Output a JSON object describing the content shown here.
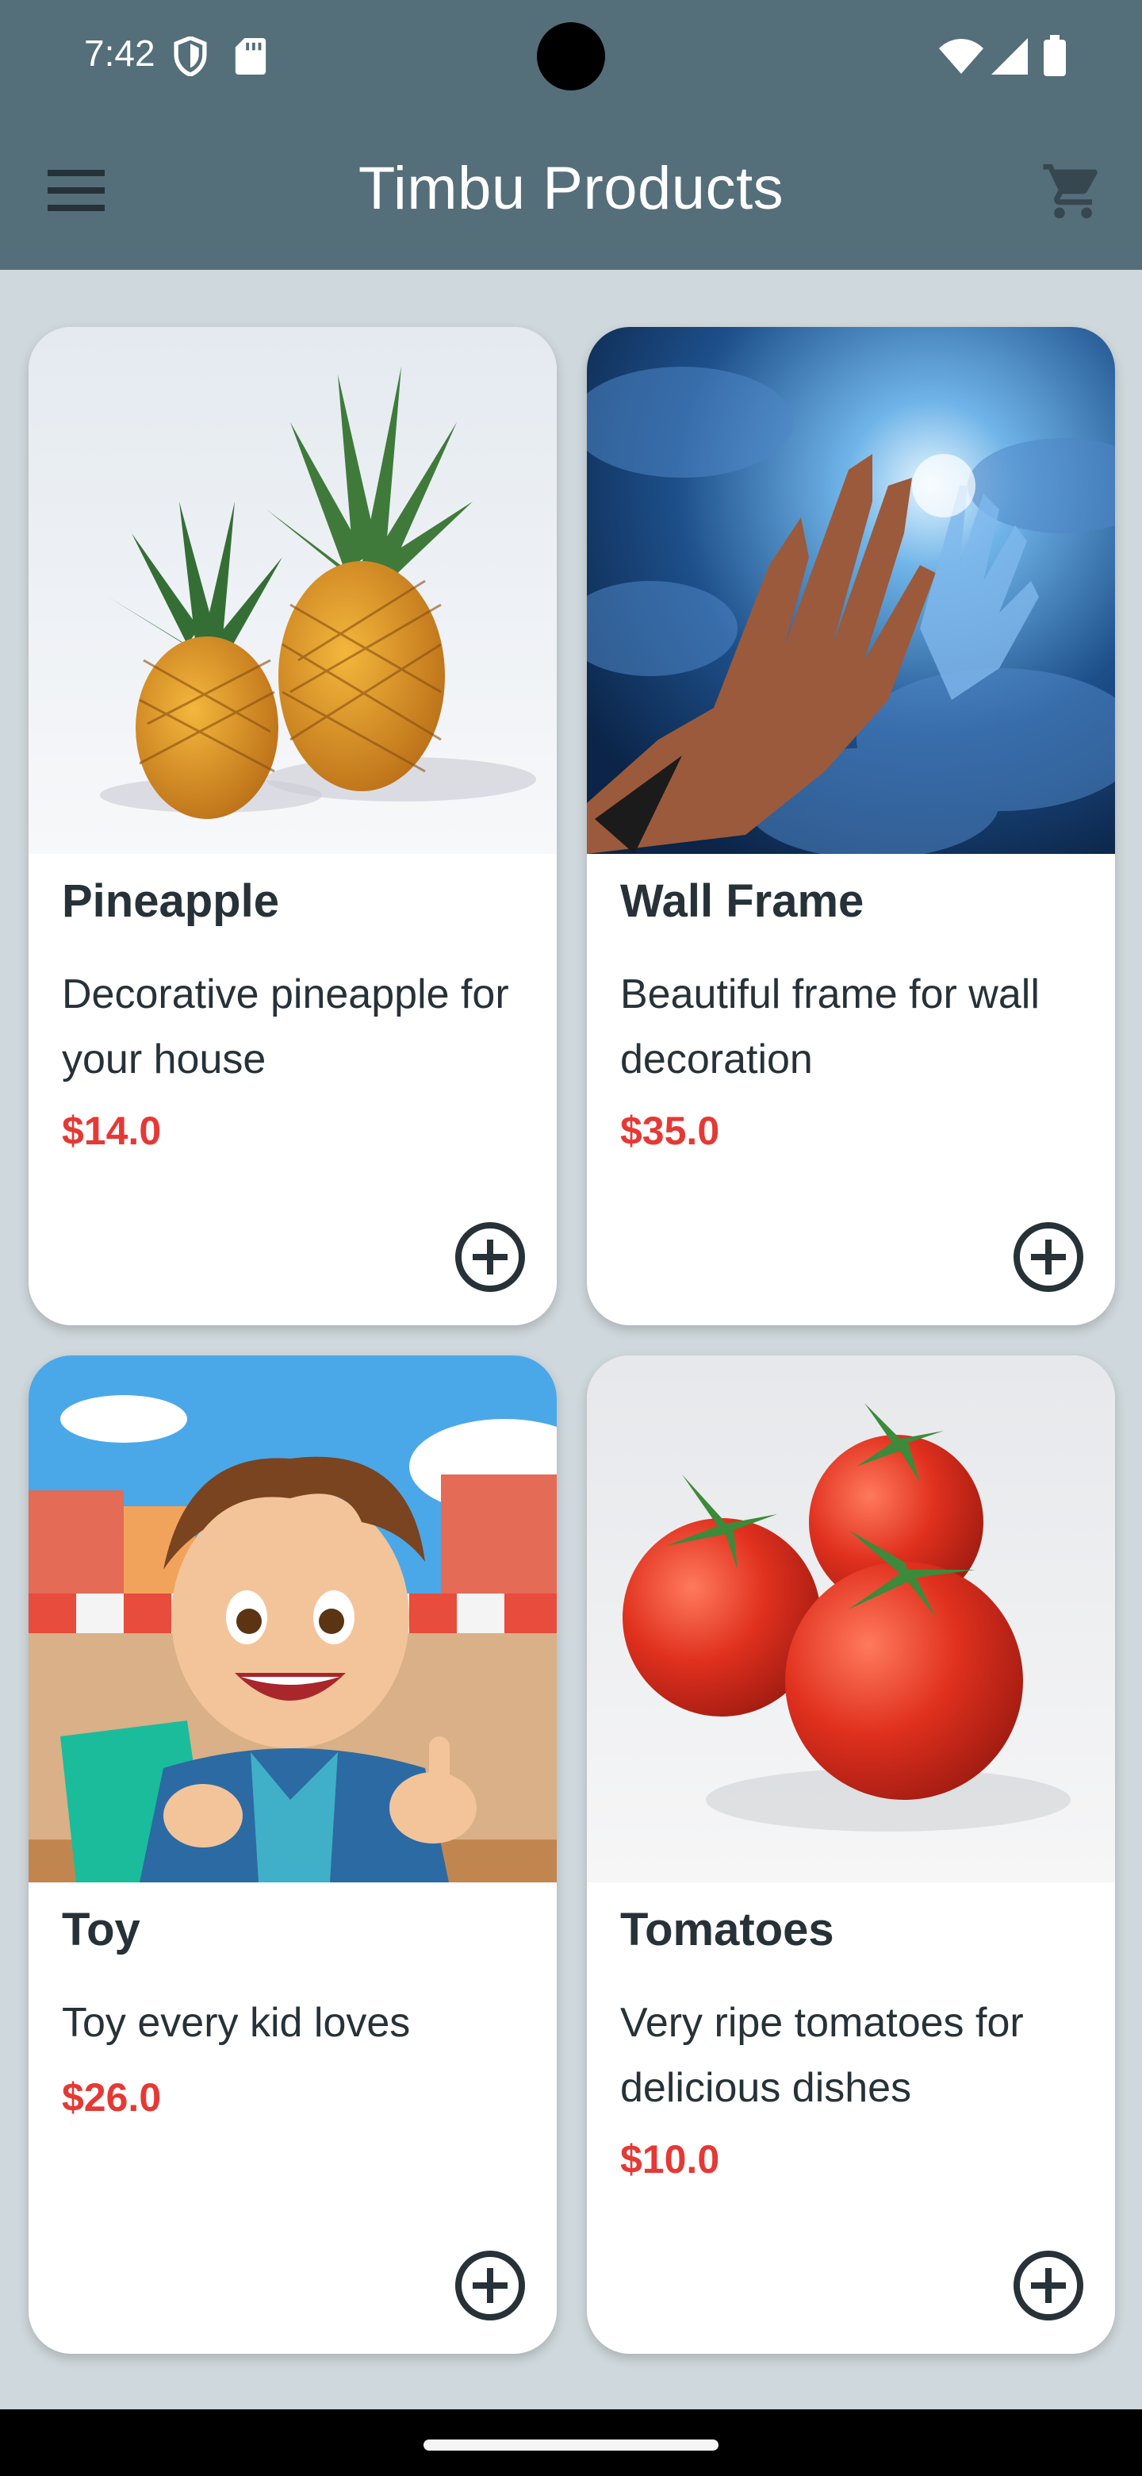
{
  "status_bar": {
    "time": "7:42",
    "icons": [
      "shield-icon",
      "sd-card-icon",
      "wifi-icon",
      "signal-icon",
      "battery-icon"
    ]
  },
  "app_bar": {
    "title": "Timbu Products",
    "menu_icon": "menu-icon",
    "cart_icon": "cart-icon",
    "background": "#546e7a"
  },
  "products": [
    {
      "name": "Pineapple",
      "description": "Decorative pineapple for your house",
      "price": "$14.0",
      "image": "pineapple-image"
    },
    {
      "name": "Wall Frame",
      "description": "Beautiful frame for wall decoration",
      "price": "$35.0",
      "image": "wall-frame-image"
    },
    {
      "name": "Toy",
      "description": "Toy every kid loves",
      "price": "$26.0",
      "image": "toy-image"
    },
    {
      "name": "Tomatoes",
      "description": "Very ripe tomatoes for delicious dishes",
      "price": "$10.0",
      "image": "tomatoes-image"
    }
  ],
  "colors": {
    "page_background": "#cfd8dc",
    "price": "#e53935",
    "text": "#263238"
  }
}
